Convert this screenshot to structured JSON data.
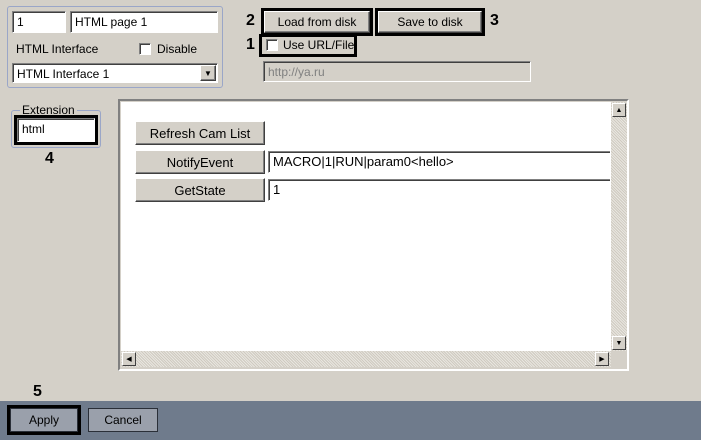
{
  "page": {
    "id_value": "1",
    "name_value": "HTML page 1",
    "interface_label": "HTML Interface",
    "disable_label": "Disable",
    "interface_select": "HTML Interface 1"
  },
  "toolbar": {
    "load_label": "Load from disk",
    "save_label": "Save to disk",
    "use_url_label": "Use URL/File:",
    "url_value": "http://ya.ru"
  },
  "extension": {
    "group_label": "Extension",
    "value": "html"
  },
  "callouts": [
    "1",
    "2",
    "3",
    "4",
    "5"
  ],
  "preview": {
    "refresh_label": "Refresh Cam List",
    "notify_label": "NotifyEvent",
    "notify_value": "MACRO|1|RUN|param0<hello>",
    "getstate_label": "GetState",
    "getstate_value": "1"
  },
  "footer": {
    "apply_label": "Apply",
    "cancel_label": "Cancel"
  },
  "colors": {
    "background": "#d4d0c8",
    "footer_bar": "#6f7b8c",
    "highlight": "#000000"
  }
}
